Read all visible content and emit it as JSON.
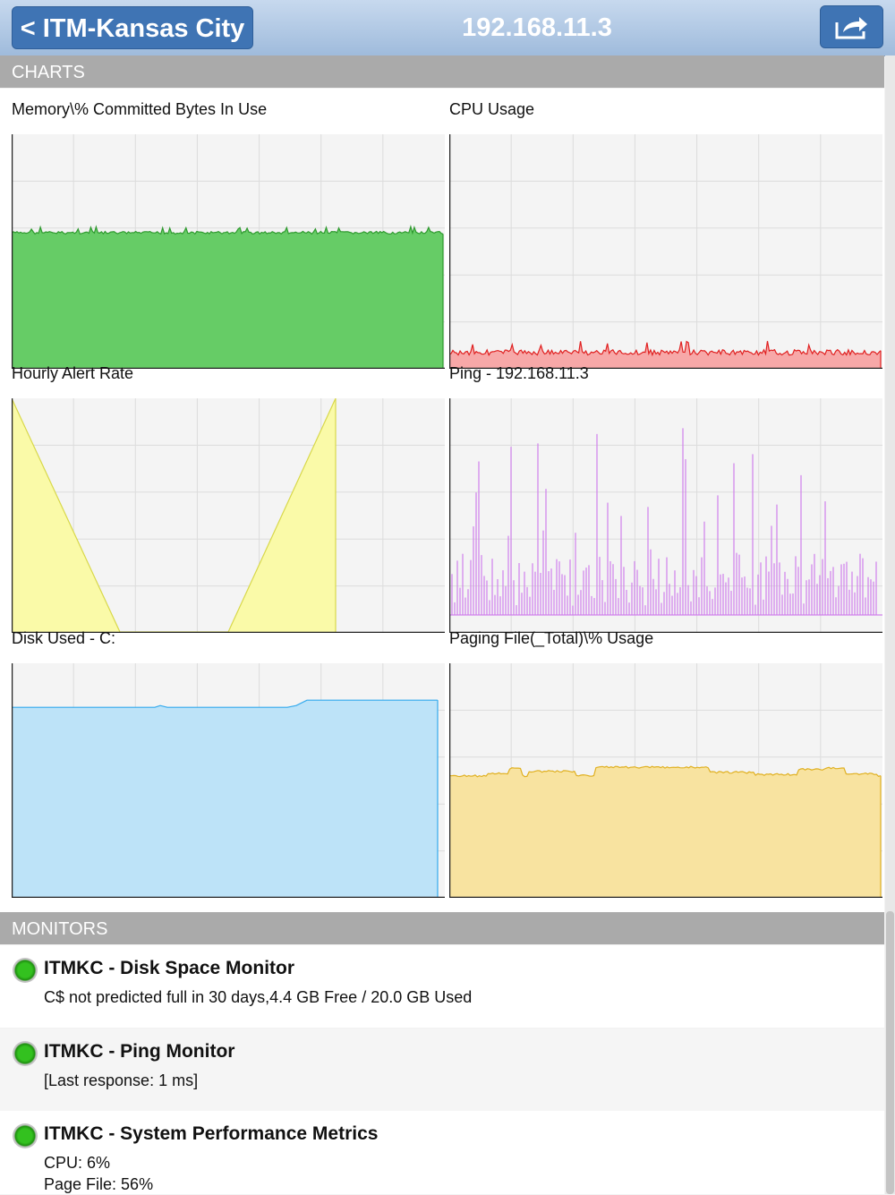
{
  "nav": {
    "back_label": "< ITM-Kansas City",
    "title": "192.168.11.3",
    "share_icon": "share-icon"
  },
  "charts_header": "CHARTS",
  "monitors_header": "MONITORS",
  "charts": [
    {
      "key": "memory",
      "title": "Memory\\% Committed Bytes In Use",
      "stroke": "#2f9a2f",
      "fill": "#66cc66",
      "level_fraction": 0.58
    },
    {
      "key": "cpu",
      "title": "CPU Usage",
      "stroke": "#e02020",
      "fill": "#f7a8a8",
      "level_fraction": 0.07
    },
    {
      "key": "alert",
      "title": "Hourly Alert Rate",
      "stroke": "#d8d84a",
      "fill": "#fafaa8"
    },
    {
      "key": "ping",
      "title": "Ping - 192.168.11.3",
      "stroke": "#d080ec",
      "fill": "none",
      "peak_ms": 1
    },
    {
      "key": "disk",
      "title": "Disk Used - C:",
      "stroke": "#33aaee",
      "fill": "#bde3f8",
      "level_fraction": 0.82
    },
    {
      "key": "paging",
      "title": "Paging File(_Total)\\% Usage",
      "stroke": "#e0b020",
      "fill": "#f8e3a0",
      "level_fraction": 0.52
    }
  ],
  "monitors": [
    {
      "name": "ITMKC - Disk Space Monitor",
      "details": [
        "C$ not predicted full in 30 days,4.4 GB Free / 20.0 GB Used"
      ],
      "status": "green"
    },
    {
      "name": "ITMKC - Ping Monitor",
      "details": [
        "[Last response: 1 ms]"
      ],
      "status": "green"
    },
    {
      "name": "ITMKC - System Performance Metrics",
      "details": [
        "CPU: 6%",
        "Page File: 56%"
      ],
      "status": "green"
    }
  ]
}
